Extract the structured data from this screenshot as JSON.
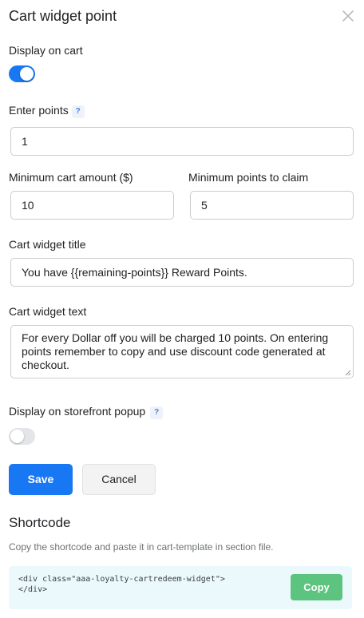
{
  "header": {
    "title": "Cart widget point"
  },
  "display_on_cart": {
    "label": "Display on cart",
    "enabled": true
  },
  "enter_points": {
    "label": "Enter points",
    "help": "?",
    "value": "1"
  },
  "min_cart_amount": {
    "label": "Minimum cart amount ($)",
    "value": "10"
  },
  "min_points_claim": {
    "label": "Minimum points to claim",
    "value": "5"
  },
  "widget_title": {
    "label": "Cart widget title",
    "value": "You have {{remaining-points}} Reward Points."
  },
  "widget_text": {
    "label": "Cart widget text",
    "value": "For every Dollar off you will be charged 10 points. On entering points remember to copy and use discount code generated at checkout."
  },
  "storefront_popup": {
    "label": "Display on storefront popup",
    "help": "?",
    "enabled": false
  },
  "actions": {
    "save_label": "Save",
    "cancel_label": "Cancel"
  },
  "shortcode": {
    "title": "Shortcode",
    "hint": "Copy the shortcode and paste it in cart-template in section file.",
    "code": "<div class=\"aaa-loyalty-cartredeem-widget\">\n</div>",
    "copy_label": "Copy"
  },
  "colors": {
    "primary": "#1877f2",
    "copy_button": "#5cc47e",
    "code_background": "#ebf9fc"
  }
}
